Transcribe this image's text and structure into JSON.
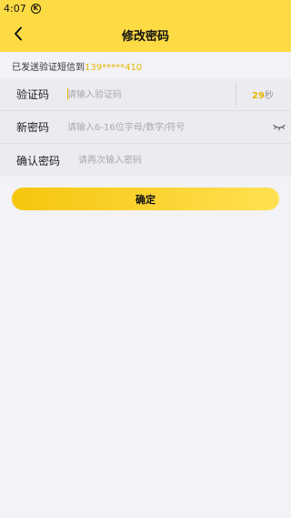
{
  "status_bar": {
    "time": "4:07",
    "notification_badge": "K"
  },
  "header": {
    "title": "修改密码",
    "back_icon": "chevron-left-icon"
  },
  "notice": {
    "text": "已发送验证短信到",
    "phone": "139*****410"
  },
  "form": {
    "code": {
      "label": "验证码",
      "placeholder": "请输入验证码",
      "countdown_value": "29",
      "countdown_unit": "秒"
    },
    "new_password": {
      "label": "新密码",
      "placeholder": "请输入6-16位字母/数字/符号",
      "toggle_icon": "eye-closed-icon"
    },
    "confirm_password": {
      "label": "确认密码",
      "placeholder": "请再次输入密码"
    }
  },
  "actions": {
    "confirm_label": "确定"
  },
  "colors": {
    "accent": "#fddb44",
    "highlight": "#e6b600",
    "background": "#f2f2f7"
  }
}
